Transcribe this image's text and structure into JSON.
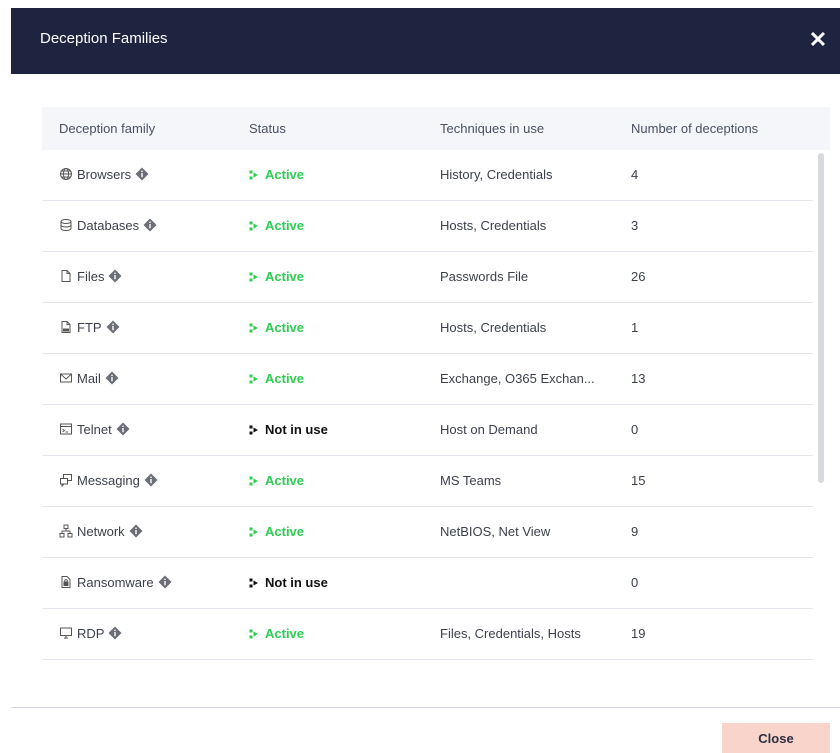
{
  "modal": {
    "title": "Deception Families",
    "close_button_label": "Close"
  },
  "table": {
    "headers": [
      "Deception family",
      "Status",
      "Techniques in use",
      "Number of deceptions"
    ],
    "rows": [
      {
        "family": "Browsers",
        "icon": "globe-icon",
        "status": "Active",
        "active": true,
        "techniques": "History, Credentials",
        "count": "4"
      },
      {
        "family": "Databases",
        "icon": "database-icon",
        "status": "Active",
        "active": true,
        "techniques": "Hosts, Credentials",
        "count": "3"
      },
      {
        "family": "Files",
        "icon": "file-icon",
        "status": "Active",
        "active": true,
        "techniques": "Passwords File",
        "count": "26"
      },
      {
        "family": "FTP",
        "icon": "ftp-file-icon",
        "status": "Active",
        "active": true,
        "techniques": "Hosts, Credentials",
        "count": "1"
      },
      {
        "family": "Mail",
        "icon": "mail-icon",
        "status": "Active",
        "active": true,
        "techniques": "Exchange, O365 Exchan...",
        "count": "13"
      },
      {
        "family": "Telnet",
        "icon": "terminal-icon",
        "status": "Not in use",
        "active": false,
        "techniques": "Host on Demand",
        "count": "0"
      },
      {
        "family": "Messaging",
        "icon": "chat-icon",
        "status": "Active",
        "active": true,
        "techniques": "MS Teams",
        "count": "15"
      },
      {
        "family": "Network",
        "icon": "network-icon",
        "status": "Active",
        "active": true,
        "techniques": "NetBIOS, Net View",
        "count": "9"
      },
      {
        "family": "Ransomware",
        "icon": "ransomware-icon",
        "status": "Not in use",
        "active": false,
        "techniques": "",
        "count": "0"
      },
      {
        "family": "RDP",
        "icon": "monitor-icon",
        "status": "Active",
        "active": true,
        "techniques": "Files, Credentials, Hosts",
        "count": "19"
      }
    ]
  },
  "colors": {
    "header_bg": "#1e2340",
    "active": "#2ecc52",
    "inactive": "#111111",
    "close_button_bg": "#f9d4cb"
  }
}
